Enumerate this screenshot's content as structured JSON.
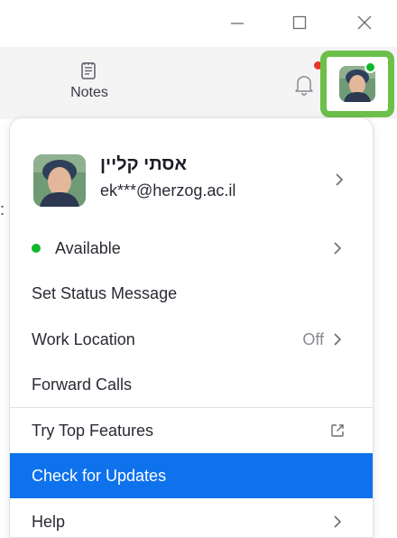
{
  "window": {
    "minimize_label": "—",
    "maximize_label": "☐",
    "close_label": "✕"
  },
  "toolbar": {
    "notes_label": "Notes",
    "notes_icon": "notes-icon",
    "bell_icon": "bell-icon"
  },
  "side_text": ":",
  "profile": {
    "name": "אסתי קליין",
    "email": "ek***@herzog.ac.il"
  },
  "menu": {
    "status_label": "Available",
    "set_status_label": "Set Status Message",
    "work_location_label": "Work Location",
    "work_location_value": "Off",
    "forward_calls_label": "Forward Calls",
    "top_features_label": "Try Top Features",
    "check_updates_label": "Check for Updates",
    "help_label": "Help"
  },
  "colors": {
    "highlight": "#6cc04a",
    "status_available": "#10b82b",
    "active_row": "#0e72ed",
    "notification_dot": "#e8352d"
  }
}
